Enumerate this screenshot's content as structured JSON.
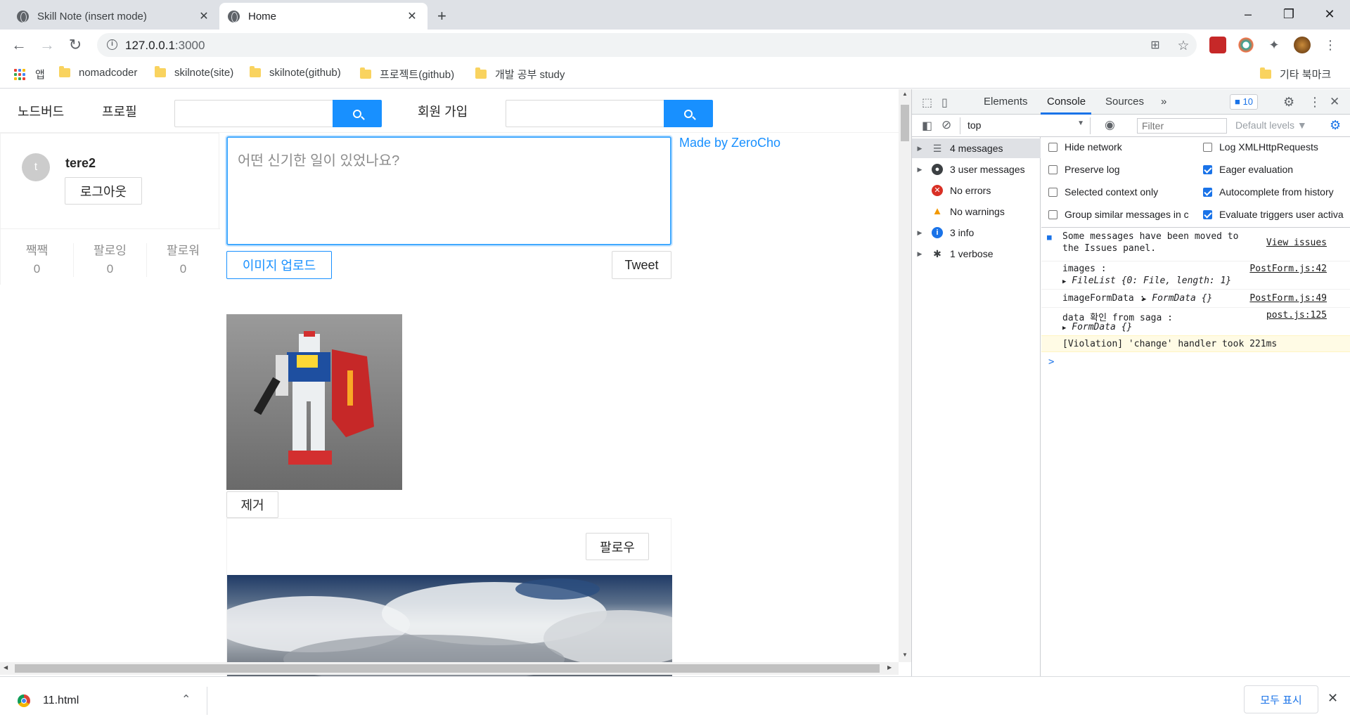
{
  "browser": {
    "tabs": [
      {
        "title": "Skill Note (insert mode)",
        "active": false
      },
      {
        "title": "Home",
        "active": true
      }
    ],
    "url_host": "127.0.0.1",
    "url_port": ":3000"
  },
  "bookmarks": {
    "apps_label": "앱",
    "items": [
      "nomadcoder",
      "skilnote(site)",
      "skilnote(github)",
      "프로젝트(github)",
      "개발 공부 study"
    ],
    "other_label": "기타 북마크"
  },
  "page": {
    "menu": {
      "home": "노드버드",
      "profile": "프로필",
      "signup": "회원 가입"
    },
    "user": {
      "avatar_letter": "t",
      "nickname": "tere2",
      "logout_label": "로그아웃",
      "stats": [
        {
          "label": "짹짹",
          "value": "0"
        },
        {
          "label": "팔로잉",
          "value": "0"
        },
        {
          "label": "팔로워",
          "value": "0"
        }
      ]
    },
    "post_form": {
      "placeholder": "어떤 신기한 일이 있었나요?",
      "upload_label": "이미지 업로드",
      "tweet_label": "Tweet",
      "remove_label": "제거"
    },
    "made_by": "Made by ZeroCho",
    "follow_label": "팔로우"
  },
  "devtools": {
    "tabs": [
      "Elements",
      "Console",
      "Sources",
      "»"
    ],
    "active_tab": "Console",
    "badge_count": "10",
    "context": "top",
    "filter_placeholder": "Filter",
    "levels_label": "Default levels ▼",
    "sidebar": [
      {
        "label": "4 messages",
        "icon": "list-icon"
      },
      {
        "label": "3 user messages",
        "icon": "user-icon"
      },
      {
        "label": "No errors",
        "icon": "error-icon"
      },
      {
        "label": "No warnings",
        "icon": "warning-icon"
      },
      {
        "label": "3 info",
        "icon": "info-icon"
      },
      {
        "label": "1 verbose",
        "icon": "bug-icon"
      }
    ],
    "settings": {
      "left": [
        {
          "label": "Hide network",
          "checked": false
        },
        {
          "label": "Preserve log",
          "checked": false
        },
        {
          "label": "Selected context only",
          "checked": false
        },
        {
          "label": "Group similar messages in c",
          "checked": false
        }
      ],
      "right": [
        {
          "label": "Log XMLHttpRequests",
          "checked": false
        },
        {
          "label": "Eager evaluation",
          "checked": true
        },
        {
          "label": "Autocomplete from history",
          "checked": true
        },
        {
          "label": "Evaluate triggers user activa",
          "checked": true
        }
      ]
    },
    "logs": {
      "issues_line1": "Some messages have been moved to",
      "issues_line2": "the Issues panel.",
      "issues_link": "View issues",
      "images_key": "images :",
      "images_val": "FileList {0: File, length: 1}",
      "images_src": "PostForm.js:42",
      "formdata_key": "imageFormData :",
      "formdata_val": "FormData {}",
      "formdata_src": "PostForm.js:49",
      "saga_key": "data 확인 from saga :",
      "saga_val": "FormData {}",
      "saga_src": "post.js:125",
      "violation": "[Violation] 'change' handler took 221ms",
      "prompt": ">"
    }
  },
  "downloads": {
    "file_name": "11.html",
    "show_all_label": "모두 표시"
  },
  "colors": {
    "accent": "#1890ff",
    "devtools_accent": "#1a73e8",
    "violation_bg": "#fffbe5"
  }
}
